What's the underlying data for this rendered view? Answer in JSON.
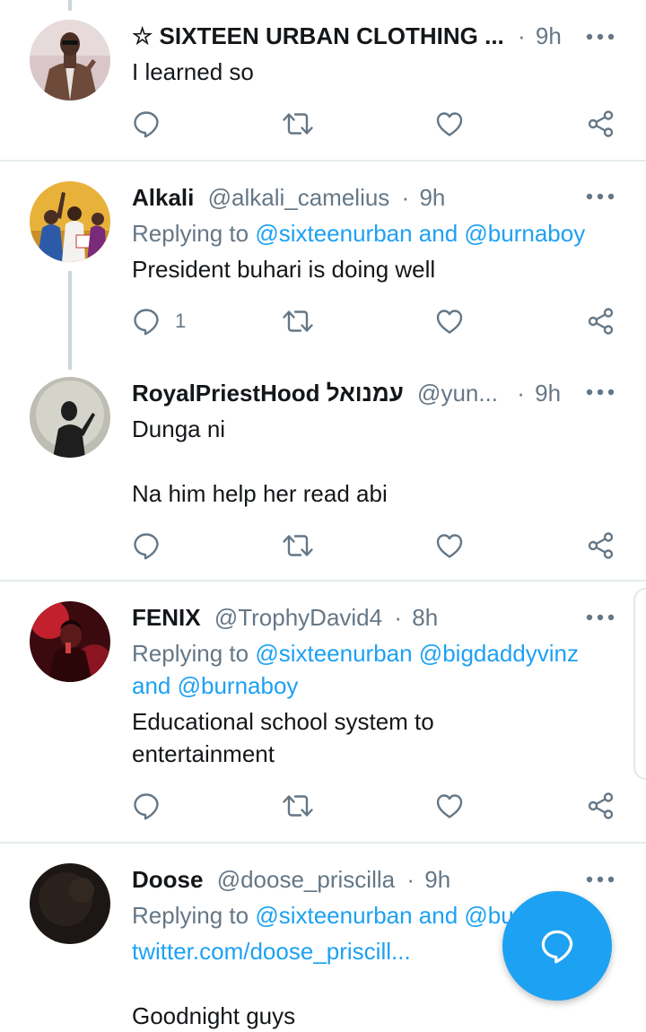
{
  "tweets": [
    {
      "name": "☆ SIXTEEN URBAN CLOTHING ...",
      "handle": "",
      "dot": "·",
      "time": "9h",
      "text": [
        "I learned so"
      ],
      "reply_count": ""
    },
    {
      "name": "Alkali",
      "handle": "@alkali_camelius",
      "dot": "·",
      "time": "9h",
      "replying_prefix": "Replying to ",
      "replying_link": "@sixteenurban and @burnaboy",
      "text": [
        "President buhari is doing well"
      ],
      "reply_count": "1"
    },
    {
      "name": "RoyalPriestHood עמנואל",
      "handle": "@yun...",
      "dot": "·",
      "time": "9h",
      "text": [
        "Dunga ni",
        "Na him help her read abi"
      ],
      "reply_count": ""
    },
    {
      "name": "FENIX",
      "handle": "@TrophyDavid4",
      "dot": "·",
      "time": "8h",
      "replying_prefix": "Replying to ",
      "replying_link": "@sixteenurban @bigdaddyvinz",
      "replying_link2": "and @burnaboy",
      "text": [
        "Educational school system to",
        "entertainment"
      ],
      "reply_count": ""
    },
    {
      "name": "Doose",
      "handle": "@doose_priscilla",
      "dot": "·",
      "time": "9h",
      "replying_prefix": "Replying to ",
      "replying_link": "@sixteenurban and @burnaboy",
      "url": "twitter.com/doose_priscill...",
      "text": [
        "Goodnight guys"
      ],
      "reply_count": ""
    }
  ],
  "colors": {
    "accent": "#1da1f2",
    "muted": "#657786",
    "divider": "#e6ecf0"
  },
  "icons": [
    "more-icon",
    "reply-icon",
    "retweet-icon",
    "like-icon",
    "share-icon",
    "compose-reply-icon"
  ]
}
